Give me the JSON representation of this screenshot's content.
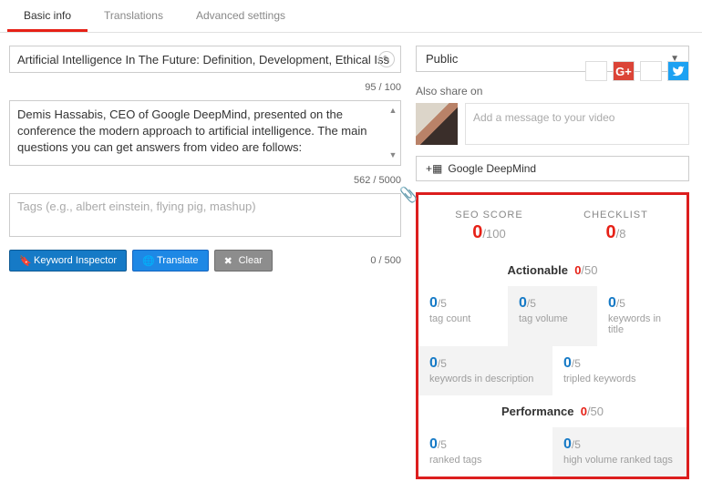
{
  "tabs": [
    "Basic info",
    "Translations",
    "Advanced settings"
  ],
  "title": {
    "value": "Artificial Intelligence In The Future: Definition, Development, Ethical Iss",
    "counter": "95 / 100"
  },
  "description": {
    "value": "Demis Hassabis, CEO of Google DeepMind, presented on the conference the modern approach to artificial intelligence. The main questions you can get answers from video are follows:",
    "counter": "562 / 5000"
  },
  "tags": {
    "placeholder": "Tags (e.g., albert einstein, flying pig, mashup)",
    "counter": "0 / 500"
  },
  "buttons": {
    "keyword": "Keyword Inspector",
    "translate": "Translate",
    "clear": "Clear"
  },
  "privacy": {
    "value": "Public"
  },
  "share": {
    "label": "Also share on",
    "placeholder": "Add a message to your video",
    "gplus": "G+",
    "twitter": "t"
  },
  "playlist": {
    "label": "Google DeepMind"
  },
  "seo": {
    "scoreLabel": "SEO SCORE",
    "scoreNum": "0",
    "scoreDen": "/100",
    "checklistLabel": "CHECKLIST",
    "clNum": "0",
    "clDen": "/8",
    "actionable": {
      "label": "Actionable",
      "num": "0",
      "den": "/50"
    },
    "performance": {
      "label": "Performance",
      "num": "0",
      "den": "/50"
    },
    "cells": {
      "tagCount": {
        "n": "0",
        "d": "/5",
        "c": "tag count"
      },
      "tagVolume": {
        "n": "0",
        "d": "/5",
        "c": "tag volume"
      },
      "kwTitle": {
        "n": "0",
        "d": "/5",
        "c": "keywords in title"
      },
      "kwDesc": {
        "n": "0",
        "d": "/5",
        "c": "keywords in description"
      },
      "tripled": {
        "n": "0",
        "d": "/5",
        "c": "tripled keywords"
      },
      "ranked": {
        "n": "0",
        "d": "/5",
        "c": "ranked tags"
      },
      "hvRanked": {
        "n": "0",
        "d": "/5",
        "c": "high volume ranked tags"
      }
    }
  }
}
